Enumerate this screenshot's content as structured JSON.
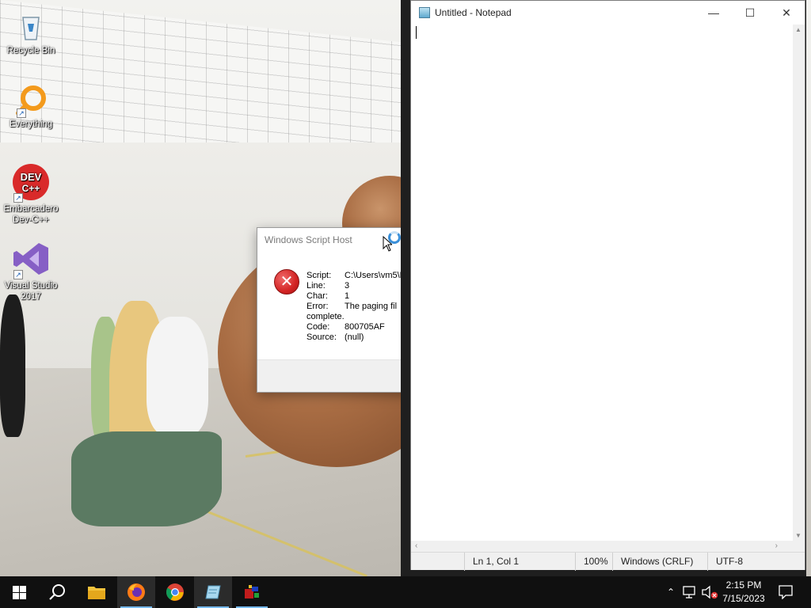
{
  "desktop": {
    "icons": [
      {
        "label": "Recycle Bin",
        "icon": "recycle-bin-icon"
      },
      {
        "label": "Everything",
        "icon": "everything-search-icon"
      },
      {
        "label": "Embarcadero Dev-C++",
        "icon": "devcpp-icon"
      },
      {
        "label": "Visual Studio 2017",
        "icon": "visual-studio-icon"
      }
    ]
  },
  "wsh_dialog": {
    "title": "Windows Script Host",
    "rows": [
      {
        "key": "Script:",
        "value": "C:\\Users\\vm5\\D"
      },
      {
        "key": "Line:",
        "value": "3"
      },
      {
        "key": "Char:",
        "value": "1"
      },
      {
        "key": "Error:",
        "value": "The paging fil"
      },
      {
        "key": "",
        "value": "complete."
      },
      {
        "key": "Code:",
        "value": "800705AF"
      },
      {
        "key": "Source:",
        "value": "(null)"
      }
    ],
    "icon": "error-icon"
  },
  "notepad": {
    "title": "Untitled - Notepad",
    "text": "",
    "controls": {
      "minimize": "—",
      "maximize": "☐",
      "close": "✕"
    },
    "status": {
      "position": "Ln 1, Col 1",
      "zoom": "100%",
      "line_ending": "Windows (CRLF)",
      "encoding": "UTF-8"
    }
  },
  "taskbar": {
    "apps": [
      "start-icon",
      "search-icon",
      "file-explorer-icon",
      "firefox-icon",
      "chrome-icon",
      "notepad-icon",
      "devcpp-icon"
    ],
    "active_app": "notepad-icon",
    "clock": {
      "time": "2:15 PM",
      "date": "7/15/2023"
    },
    "accent": "#76b9ed"
  }
}
